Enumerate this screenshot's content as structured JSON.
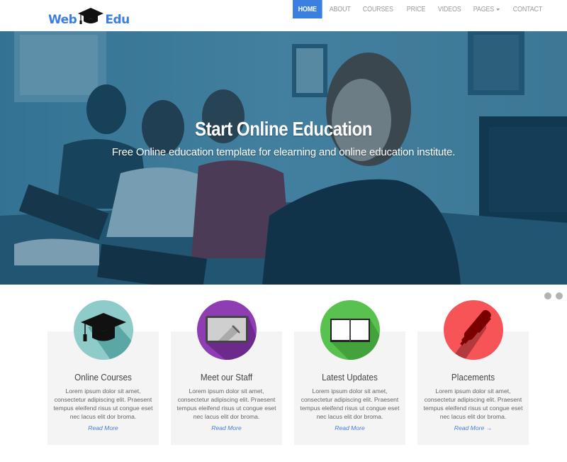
{
  "brand": {
    "left": "Web",
    "right": "Edu",
    "icon": "graduation-cap-icon",
    "color": "#3b7fe0"
  },
  "nav": {
    "items": [
      {
        "label": "HOME",
        "active": true
      },
      {
        "label": "ABOUT",
        "active": false
      },
      {
        "label": "COURSES",
        "active": false
      },
      {
        "label": "PRICE",
        "active": false
      },
      {
        "label": "VIDEOS",
        "active": false
      },
      {
        "label": "PAGES",
        "active": false,
        "dropdown": true
      },
      {
        "label": "CONTACT",
        "active": false
      }
    ],
    "active_color": "#3b7fe0"
  },
  "hero": {
    "title": "Start Online Education",
    "subtitle": "Free Online education template for elearning and online education institute."
  },
  "slider": {
    "dots": 2
  },
  "features": [
    {
      "title": "Online Courses",
      "text": "Lorem ipsum dolor sit amet, consectetur adipiscing elit. Praesent tempus eleifend risus ut congue eset nec lacus elit dor broma.",
      "link": "Read More",
      "icon": "graduation-cap-icon",
      "color": "#8ecbc9"
    },
    {
      "title": "Meet our Staff",
      "text": "Lorem ipsum dolor sit amet, consectetur adipiscing elit. Praesent tempus eleifend risus ut congue eset nec lacus elit dor broma.",
      "link": "Read More",
      "icon": "whiteboard-icon",
      "color": "#8e3db3"
    },
    {
      "title": "Latest Updates",
      "text": "Lorem ipsum dolor sit amet, consectetur adipiscing elit. Praesent tempus eleifend risus ut congue eset nec lacus elit dor broma.",
      "link": "Read More",
      "icon": "open-book-icon",
      "color": "#59c14f"
    },
    {
      "title": "Placements",
      "text": "Lorem ipsum dolor sit amet, consectetur adipiscing elit. Praesent tempus eleifend risus ut congue eset nec lacus elit dor broma.",
      "link": "Read More →",
      "icon": "pen-icon",
      "color": "#f75457"
    }
  ]
}
